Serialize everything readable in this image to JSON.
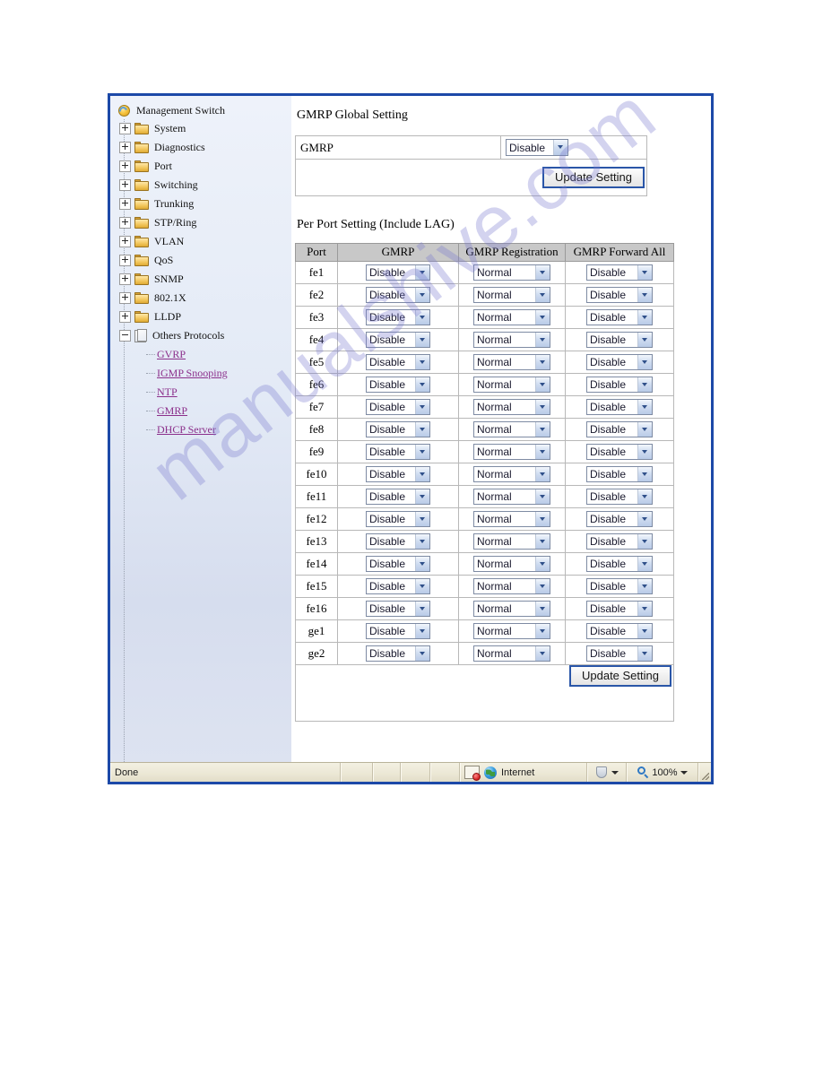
{
  "window": {
    "statusbar": {
      "status_text": "Done",
      "zone_label": "Internet",
      "zoom_label": "100%",
      "blocked_icon": "blocked-popup-icon",
      "globe_icon": "internet-zone-globe-icon",
      "shield_icon": "protected-mode-shield-icon",
      "magnifier_icon": "zoom-magnifier-icon"
    }
  },
  "sidebar": {
    "root": {
      "label": "Management Switch",
      "icon": "switch-globe-icon"
    },
    "folders": [
      {
        "label": "System",
        "icon": "folder-icon",
        "expander": "plus"
      },
      {
        "label": "Diagnostics",
        "icon": "folder-icon",
        "expander": "plus"
      },
      {
        "label": "Port",
        "icon": "folder-icon",
        "expander": "plus"
      },
      {
        "label": "Switching",
        "icon": "folder-icon",
        "expander": "plus"
      },
      {
        "label": "Trunking",
        "icon": "folder-icon",
        "expander": "plus"
      },
      {
        "label": "STP/Ring",
        "icon": "folder-icon",
        "expander": "plus"
      },
      {
        "label": "VLAN",
        "icon": "folder-icon",
        "expander": "plus"
      },
      {
        "label": "QoS",
        "icon": "folder-icon",
        "expander": "plus"
      },
      {
        "label": "SNMP",
        "icon": "folder-icon",
        "expander": "plus"
      },
      {
        "label": "802.1X",
        "icon": "folder-icon",
        "expander": "plus"
      },
      {
        "label": "LLDP",
        "icon": "folder-icon",
        "expander": "plus"
      }
    ],
    "expanded_folder": {
      "label": "Others Protocols",
      "icon": "page-icon",
      "expander": "minus"
    },
    "leaves": [
      {
        "label": "GVRP"
      },
      {
        "label": "IGMP Snooping"
      },
      {
        "label": "NTP"
      },
      {
        "label": "GMRP"
      },
      {
        "label": "DHCP Server"
      }
    ]
  },
  "main": {
    "global_section": {
      "title": "GMRP Global Setting",
      "row_label": "GMRP",
      "row_value": "Disable",
      "update_button": "Update Setting"
    },
    "port_section": {
      "title": "Per Port Setting (Include LAG)",
      "columns": [
        "Port",
        "GMRP",
        "GMRP Registration",
        "GMRP Forward All"
      ],
      "update_button": "Update Setting",
      "rows": [
        {
          "port": "fe1",
          "gmrp": "Disable",
          "registration": "Normal",
          "forward_all": "Disable"
        },
        {
          "port": "fe2",
          "gmrp": "Disable",
          "registration": "Normal",
          "forward_all": "Disable"
        },
        {
          "port": "fe3",
          "gmrp": "Disable",
          "registration": "Normal",
          "forward_all": "Disable"
        },
        {
          "port": "fe4",
          "gmrp": "Disable",
          "registration": "Normal",
          "forward_all": "Disable"
        },
        {
          "port": "fe5",
          "gmrp": "Disable",
          "registration": "Normal",
          "forward_all": "Disable"
        },
        {
          "port": "fe6",
          "gmrp": "Disable",
          "registration": "Normal",
          "forward_all": "Disable"
        },
        {
          "port": "fe7",
          "gmrp": "Disable",
          "registration": "Normal",
          "forward_all": "Disable"
        },
        {
          "port": "fe8",
          "gmrp": "Disable",
          "registration": "Normal",
          "forward_all": "Disable"
        },
        {
          "port": "fe9",
          "gmrp": "Disable",
          "registration": "Normal",
          "forward_all": "Disable"
        },
        {
          "port": "fe10",
          "gmrp": "Disable",
          "registration": "Normal",
          "forward_all": "Disable"
        },
        {
          "port": "fe11",
          "gmrp": "Disable",
          "registration": "Normal",
          "forward_all": "Disable"
        },
        {
          "port": "fe12",
          "gmrp": "Disable",
          "registration": "Normal",
          "forward_all": "Disable"
        },
        {
          "port": "fe13",
          "gmrp": "Disable",
          "registration": "Normal",
          "forward_all": "Disable"
        },
        {
          "port": "fe14",
          "gmrp": "Disable",
          "registration": "Normal",
          "forward_all": "Disable"
        },
        {
          "port": "fe15",
          "gmrp": "Disable",
          "registration": "Normal",
          "forward_all": "Disable"
        },
        {
          "port": "fe16",
          "gmrp": "Disable",
          "registration": "Normal",
          "forward_all": "Disable"
        },
        {
          "port": "ge1",
          "gmrp": "Disable",
          "registration": "Normal",
          "forward_all": "Disable"
        },
        {
          "port": "ge2",
          "gmrp": "Disable",
          "registration": "Normal",
          "forward_all": "Disable"
        }
      ]
    }
  },
  "watermark": {
    "text": "manualshive.com"
  },
  "colors": {
    "window_border": "#1c49a8",
    "button_border": "#2a56a8",
    "table_header_bg": "#c8c8c8",
    "link": "#8b2f8b",
    "statusbar_bg": "#ece8d6"
  }
}
